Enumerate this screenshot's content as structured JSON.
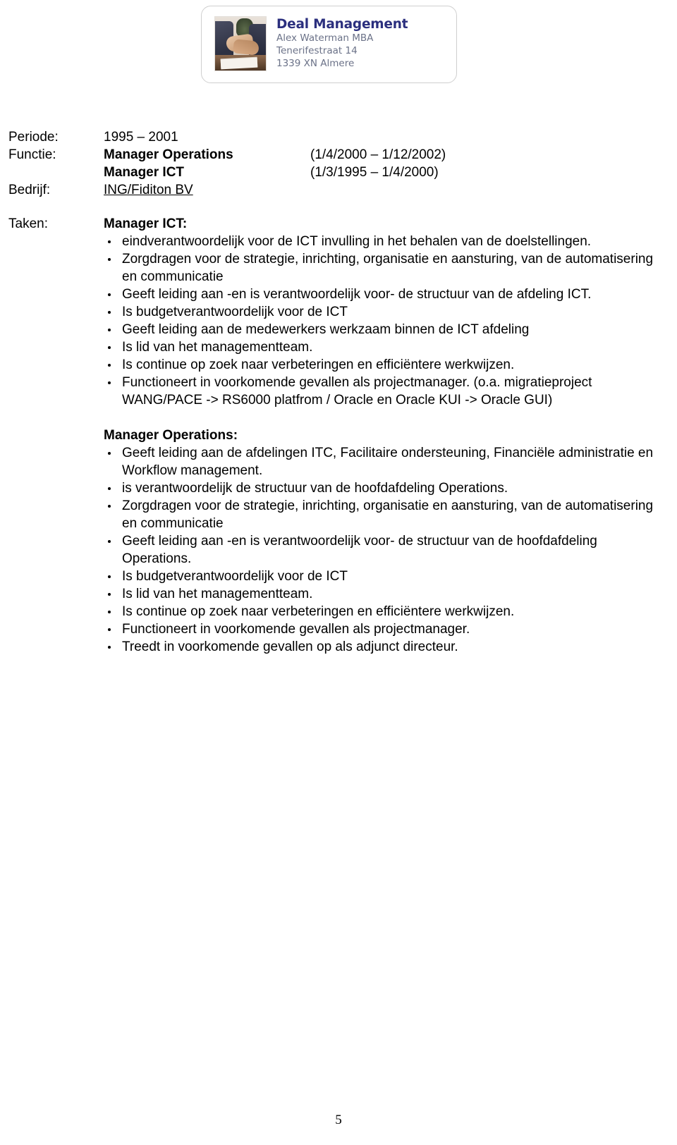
{
  "letterhead": {
    "logo_alt": "handshake-photo",
    "company": "Deal Management",
    "person": "Alex Waterman MBA",
    "street": "Tenerifestraat 14",
    "city": "1339 XN  Almere",
    "title_color": "#2b2f7e",
    "address_color": "#6b7288",
    "border_color": "#cfcfcf"
  },
  "meta": {
    "rows": [
      {
        "label": "Periode:",
        "value": "1995 – 2001",
        "date": "",
        "bold": false,
        "underline": false
      },
      {
        "label": "Functie:",
        "value": "Manager Operations",
        "date": "(1/4/2000 – 1/12/2002)",
        "bold": true,
        "underline": false
      },
      {
        "label": "",
        "value": "Manager ICT",
        "date": "(1/3/1995 – 1/4/2000)",
        "bold": true,
        "underline": false
      },
      {
        "label": "Bedrijf:",
        "value": "ING/Fiditon BV",
        "date": "",
        "bold": false,
        "underline": true
      }
    ]
  },
  "taken": {
    "label": "Taken:",
    "sections": [
      {
        "heading": "Manager ICT:",
        "items": [
          "eindverantwoordelijk voor de ICT invulling in het behalen van de doelstellingen.",
          "Zorgdragen voor de strategie, inrichting, organisatie en aansturing, van de automatisering en communicatie",
          "Geeft leiding aan -en is verantwoordelijk voor- de structuur van de afdeling ICT.",
          "Is budgetverantwoordelijk voor de ICT",
          "Geeft leiding aan de medewerkers werkzaam binnen de ICT afdeling",
          "Is lid van het managementteam.",
          "Is continue op zoek naar verbeteringen en efficiëntere werkwijzen.",
          "Functioneert in voorkomende gevallen als projectmanager. (o.a. migratieproject WANG/PACE -> RS6000 platfrom / Oracle en Oracle KUI -> Oracle GUI)"
        ]
      },
      {
        "heading": "Manager Operations:",
        "items": [
          "Geeft leiding aan de afdelingen ITC, Facilitaire ondersteuning, Financiële administratie en Workflow management.",
          "is verantwoordelijk de structuur van de hoofdafdeling Operations.",
          "Zorgdragen voor de strategie, inrichting, organisatie en aansturing, van de automatisering en communicatie",
          "Geeft leiding aan -en is verantwoordelijk voor- de structuur van de hoofdafdeling Operations.",
          "Is budgetverantwoordelijk voor de ICT",
          "Is lid van het managementteam.",
          "Is continue op zoek naar verbeteringen en efficiëntere werkwijzen.",
          "Functioneert in voorkomende gevallen als projectmanager.",
          "Treedt in voorkomende gevallen op als adjunct directeur."
        ]
      }
    ]
  },
  "footer": {
    "page_number": "5"
  }
}
